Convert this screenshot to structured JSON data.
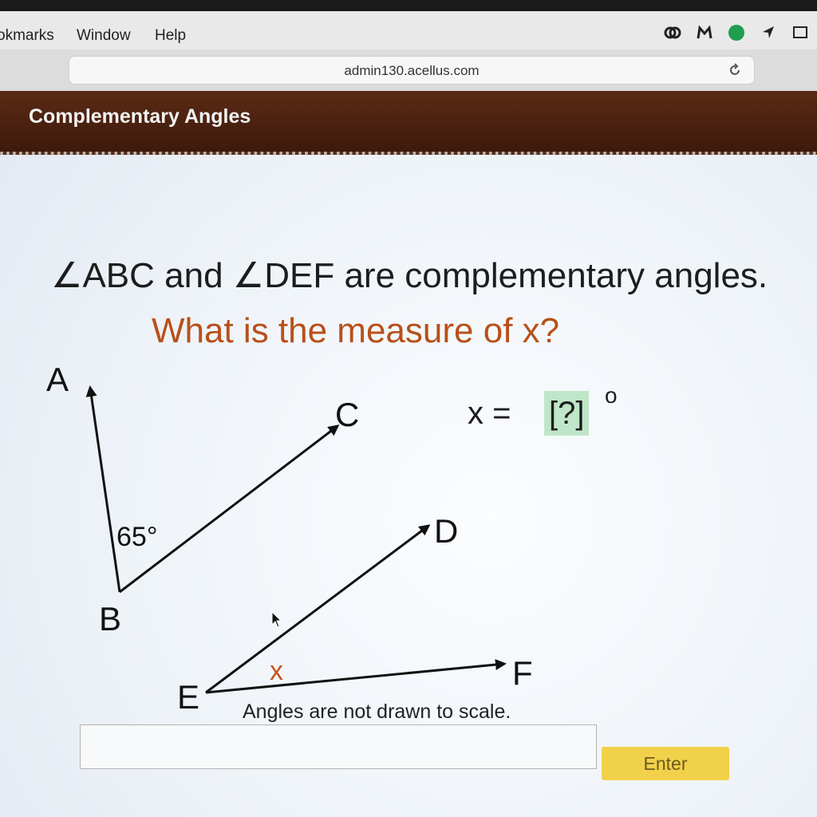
{
  "menubar": {
    "items": [
      "okmarks",
      "Window",
      "Help"
    ]
  },
  "browser": {
    "url": "admin130.acellus.com"
  },
  "course": {
    "title": "Complementary Angles"
  },
  "question": {
    "line1": "∠ABC and ∠DEF are complementary angles.",
    "line2": "What is the measure of x?",
    "answer_label": "x =",
    "answer_placeholder": "[?]",
    "degree": "o"
  },
  "diagram": {
    "labels": {
      "A": "A",
      "B": "B",
      "C": "C",
      "D": "D",
      "E": "E",
      "F": "F"
    },
    "angle_abc": "65°",
    "angle_def": "x"
  },
  "note": "Angles are not drawn to scale.",
  "input": {
    "value": ""
  },
  "enter_label": "Enter",
  "colors": {
    "header": "#4a200e",
    "question_accent": "#b8501a",
    "answer_highlight": "#bfe6c8",
    "enter_button": "#f2d14a"
  }
}
